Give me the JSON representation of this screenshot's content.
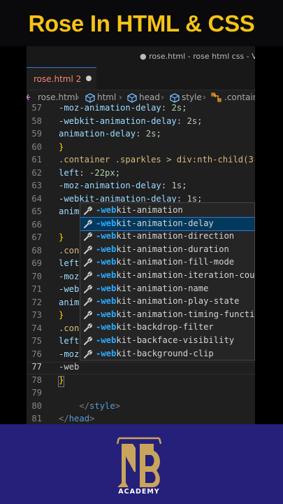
{
  "banner": {
    "title": "Rose In HTML & CSS"
  },
  "window": {
    "title": "● rose.html - rose html css - Visu"
  },
  "tab": {
    "label": "rose.html 2"
  },
  "breadcrumb": {
    "items": [
      "rose.html",
      "html",
      "head",
      "style",
      ".contain"
    ]
  },
  "code": {
    "lines": [
      {
        "n": "57",
        "segs": [
          {
            "c": "prop",
            "t": "-moz-animation-delay"
          },
          {
            "c": "pun",
            "t": ": "
          },
          {
            "c": "num",
            "t": "2s"
          },
          {
            "c": "pun",
            "t": ";"
          }
        ]
      },
      {
        "n": "58",
        "segs": [
          {
            "c": "prop",
            "t": "-webkit-animation-delay"
          },
          {
            "c": "pun",
            "t": ": "
          },
          {
            "c": "num",
            "t": "2s"
          },
          {
            "c": "pun",
            "t": ";"
          }
        ]
      },
      {
        "n": "59",
        "segs": [
          {
            "c": "prop",
            "t": "animation-delay"
          },
          {
            "c": "pun",
            "t": ": "
          },
          {
            "c": "num",
            "t": "2s"
          },
          {
            "c": "pun",
            "t": ";"
          }
        ]
      },
      {
        "n": "60",
        "segs": [
          {
            "c": "brace",
            "t": "}"
          }
        ]
      },
      {
        "n": "61",
        "segs": [
          {
            "c": "sel",
            "t": ".container .sparkles > div:nth-child(3"
          }
        ]
      },
      {
        "n": "62",
        "segs": [
          {
            "c": "prop",
            "t": "left"
          },
          {
            "c": "pun",
            "t": ": "
          },
          {
            "c": "num",
            "t": "-22px"
          },
          {
            "c": "pun",
            "t": ";"
          }
        ]
      },
      {
        "n": "63",
        "segs": [
          {
            "c": "prop",
            "t": "-moz-animation-delay"
          },
          {
            "c": "pun",
            "t": ": "
          },
          {
            "c": "num",
            "t": "1s"
          },
          {
            "c": "pun",
            "t": ";"
          }
        ]
      },
      {
        "n": "64",
        "segs": [
          {
            "c": "prop",
            "t": "-webkit-animation-delay"
          },
          {
            "c": "pun",
            "t": ": "
          },
          {
            "c": "num",
            "t": "1s"
          },
          {
            "c": "pun",
            "t": ";"
          }
        ]
      },
      {
        "n": "65",
        "segs": [
          {
            "c": "prop",
            "t": "anim"
          }
        ]
      },
      {
        "n": "66",
        "segs": []
      },
      {
        "n": "67",
        "segs": [
          {
            "c": "brace",
            "t": "}"
          }
        ]
      },
      {
        "n": "68",
        "segs": [
          {
            "c": "sel",
            "t": ".con"
          }
        ]
      },
      {
        "n": "69",
        "segs": [
          {
            "c": "prop",
            "t": "left"
          }
        ]
      },
      {
        "n": "70",
        "segs": [
          {
            "c": "prop",
            "t": "-moz"
          }
        ]
      },
      {
        "n": "71",
        "segs": [
          {
            "c": "prop",
            "t": "-web"
          }
        ]
      },
      {
        "n": "72",
        "segs": [
          {
            "c": "prop",
            "t": "anim"
          }
        ]
      },
      {
        "n": "73",
        "segs": [
          {
            "c": "brace",
            "t": "}"
          }
        ]
      },
      {
        "n": "74",
        "segs": [
          {
            "c": "sel",
            "t": ".con"
          }
        ]
      },
      {
        "n": "75",
        "segs": [
          {
            "c": "prop",
            "t": "left"
          }
        ]
      },
      {
        "n": "76",
        "segs": [
          {
            "c": "prop",
            "t": "-moz"
          }
        ]
      },
      {
        "n": "77",
        "segs": [
          {
            "c": "pun",
            "t": "-web"
          }
        ]
      },
      {
        "n": "78",
        "segs": [
          {
            "c": "brace",
            "t": "}"
          }
        ]
      },
      {
        "n": "79",
        "segs": []
      },
      {
        "n": "80",
        "segs": [
          {
            "c": "pun",
            "t": "    "
          },
          {
            "c": "tag",
            "t": "</"
          },
          {
            "c": "tagn",
            "t": "style"
          },
          {
            "c": "tag",
            "t": ">"
          }
        ]
      },
      {
        "n": "81",
        "segs": [
          {
            "c": "tag",
            "t": "</"
          },
          {
            "c": "tagn",
            "t": "head"
          },
          {
            "c": "tag",
            "t": ">"
          }
        ]
      }
    ]
  },
  "suggestions": {
    "typed": "-web",
    "selected_index": 1,
    "items": [
      "-webkit-animation",
      "-webkit-animation-delay",
      "-webkit-animation-direction",
      "-webkit-animation-duration",
      "-webkit-animation-fill-mode",
      "-webkit-animation-iteration-cou",
      "-webkit-animation-name",
      "-webkit-animation-play-state",
      "-webkit-animation-timing-functi",
      "-webkit-backdrop-filter",
      "-webkit-backface-visibility",
      "-webkit-background-clip"
    ]
  },
  "footer": {
    "logo_text": "ACADEMY"
  },
  "colors": {
    "banner_text": "#f6c316",
    "footer_bg": "#25207a",
    "editor_bg": "#1f1f1f"
  }
}
